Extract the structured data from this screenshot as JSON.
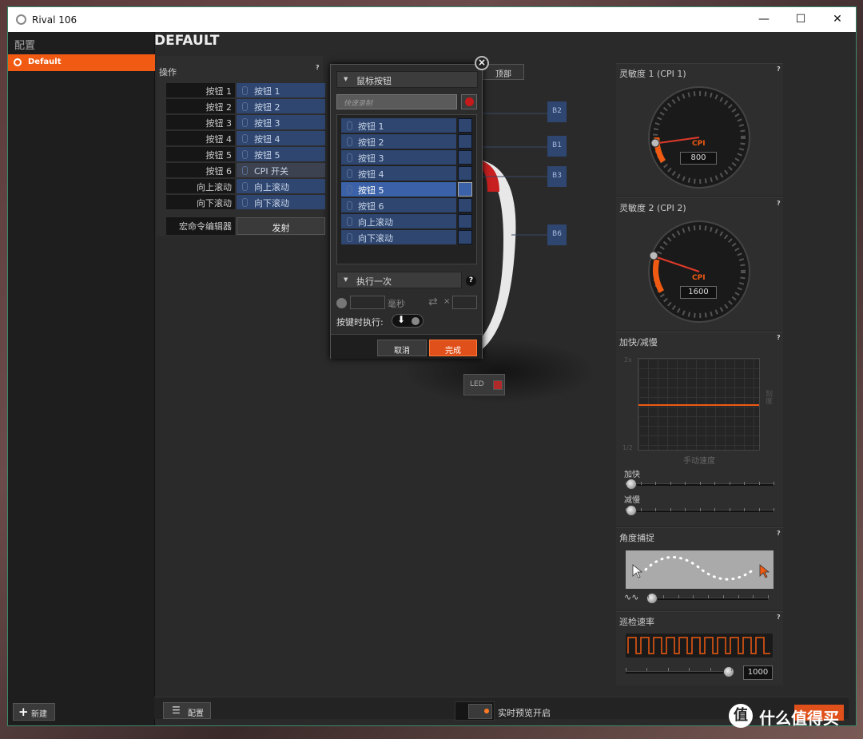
{
  "window": {
    "title": "Rival 106",
    "minimize": "—",
    "maximize": "☐",
    "close": "✕"
  },
  "sidebar": {
    "header": "配置",
    "profile": "Default",
    "new_button": "新建"
  },
  "main": {
    "title": "DEFAULT",
    "actions_label": "操作",
    "action_rows": [
      {
        "name": "按钮 1",
        "value": "按钮 1"
      },
      {
        "name": "按钮 2",
        "value": "按钮 2"
      },
      {
        "name": "按钮 3",
        "value": "按钮 3"
      },
      {
        "name": "按钮 4",
        "value": "按钮 4"
      },
      {
        "name": "按钮 5",
        "value": "按钮 5"
      },
      {
        "name": "按钮 6",
        "value": "CPI 开关"
      },
      {
        "name": "向上滚动",
        "value": "向上滚动"
      },
      {
        "name": "向下滚动",
        "value": "向下滚动"
      }
    ],
    "macro_label": "宏命令编辑器",
    "fire_label": "发射",
    "help": "?"
  },
  "popup": {
    "close": "×",
    "category": "鼠标按钮",
    "quick_record_placeholder": "快速录制",
    "items": [
      "按钮 1",
      "按钮 2",
      "按钮 3",
      "按钮 4",
      "按钮 5",
      "按钮 6",
      "向上滚动",
      "向下滚动"
    ],
    "selected_index": 4,
    "execute_mode": "执行一次",
    "help": "?",
    "delay_unit": "毫秒",
    "repeat_symbol": "×",
    "hold_label": "按键时执行:",
    "cancel": "取消",
    "done": "完成"
  },
  "mouse": {
    "top_tab": "顶部",
    "labels": [
      "B2",
      "B1",
      "B3",
      "B6"
    ],
    "led": "LED"
  },
  "right": {
    "cpi1": {
      "title": "灵敏度 1 (CPI 1)",
      "unit": "CPI",
      "value": "800"
    },
    "cpi2": {
      "title": "灵敏度 2 (CPI 2)",
      "unit": "CPI",
      "value": "1600"
    },
    "accel": {
      "title": "加快/减慢",
      "y_top": "2x",
      "y_bottom": "1/2",
      "x_label": "手动速度",
      "y_side": "刻度",
      "accel_label": "加快",
      "decel_label": "减慢"
    },
    "angle": {
      "title": "角度捕捉"
    },
    "polling": {
      "title": "巡检速率",
      "value": "1000"
    },
    "help": "?"
  },
  "bottom": {
    "config_button": "配置",
    "preview": "实时预览开启"
  },
  "watermark": {
    "glyph": "值",
    "text": "什么值得买"
  },
  "colors": {
    "accent": "#f05a12",
    "blue": "#2e4670",
    "selected": "#3b62a8"
  }
}
